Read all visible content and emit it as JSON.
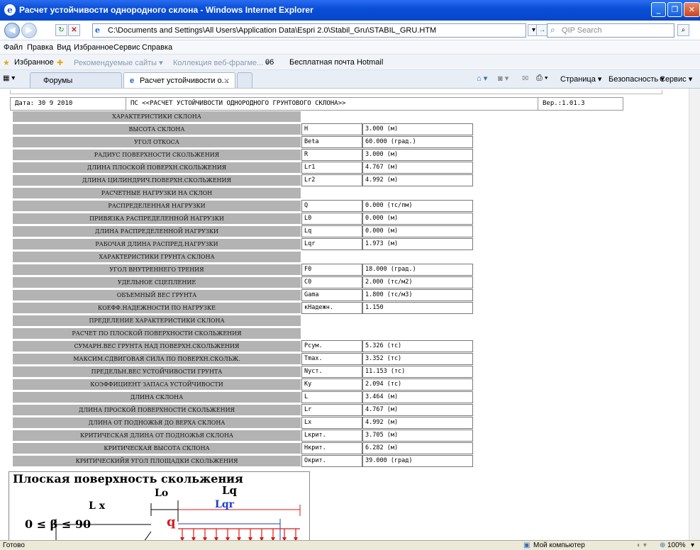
{
  "window": {
    "title": "Расчет устойчивости однородного склона - Windows Internet Explorer",
    "address": "C:\\Documents and Settings\\All Users\\Application Data\\Espri 2.0\\Stabil_Gru\\STABIL_GRU.HTM",
    "search_placeholder": "QIP Search"
  },
  "menu": [
    "Файл",
    "Правка",
    "Вид",
    "Избранное",
    "Сервис",
    "Справка"
  ],
  "favorites": {
    "label": "Избранное",
    "items": [
      "Рекомендуемые сайты ▾",
      "Коллекция веб-фрагме... ▾",
      "06",
      "Бесплатная почта Hotmail"
    ]
  },
  "tabs": {
    "left": "Форумы",
    "active": "Расчет устойчивости о...",
    "commands": [
      "Страница ▾",
      "Безопасность ▾",
      "Сервис ▾"
    ]
  },
  "report": {
    "date": "Дата: 30 9 2010",
    "heading": "ПС <<РАСЧЕТ УСТОЙЧИВОСТИ ОДНОРОДНОГО ГРУНТОВОГО СКЛОНА>>",
    "version": "Вер.:1.01.3",
    "rows": [
      {
        "label": "ХАРАКТЕРИСТИКИ СКЛОНА",
        "sym": "",
        "val": ""
      },
      {
        "label": "ВЫСОТА СКЛОНА",
        "sym": "H",
        "val": "3.000 (м)"
      },
      {
        "label": "УГОЛ ОТКОСА",
        "sym": "Beta",
        "val": "60.000 (град.)"
      },
      {
        "label": "РАДИУС ПОВЕРХНОСТИ СКОЛЬЖЕНИЯ",
        "sym": "R",
        "val": "3.000 (м)"
      },
      {
        "label": "ДЛИНА ПЛОСКОЙ ПОВЕРХН.СКОЛЬЖЕНИЯ",
        "sym": "Lr1",
        "val": "4.767 (м)"
      },
      {
        "label": "ДЛИНА ЦИЛИНДРИЧ.ПОВЕРХН.СКОЛЬЖЕНИЯ",
        "sym": "Lr2",
        "val": "4.992 (м)"
      },
      {
        "label": "РАСЧЕТНЫЕ НАГРУЗКИ НА СКЛОН",
        "sym": "",
        "val": ""
      },
      {
        "label": "РАСПРЕДЕЛЕННАЯ НАГРУЗКИ",
        "sym": "Q",
        "val": "0.000 (тс/пм)"
      },
      {
        "label": "ПРИВЯЗКА РАСПРЕДЕЛЕННОЙ НАГРУЗКИ",
        "sym": "L0",
        "val": "0.000 (м)"
      },
      {
        "label": "ДЛИНА РАСПРЕДЕЛЕННОЙ НАГРУЗКИ",
        "sym": "Lq",
        "val": "0.000 (м)"
      },
      {
        "label": "РАБОЧАЯ ДЛИНА РАСПРЕД.НАГРУЗКИ",
        "sym": "Lqr",
        "val": "1.973 (м)"
      },
      {
        "label": "ХАРАКТЕРИСТИКИ ГРУНТА СКЛОНА",
        "sym": "",
        "val": ""
      },
      {
        "label": "УГОЛ ВНУТРЕННЕГО ТРЕНИЯ",
        "sym": "F0",
        "val": "18.000 (град.)"
      },
      {
        "label": "УДЕЛЬНОЕ СЦЕПЛЕНИЕ",
        "sym": "C0",
        "val": "2.000 (тс/м2)"
      },
      {
        "label": "ОБЪЕМНЫЙ ВЕС ГРУНТА",
        "sym": "Gama",
        "val": "1.800 (тс/м3)"
      },
      {
        "label": "КОЕФФ.НАДЕЖНОСТИ ПО НАГРУЗКЕ",
        "sym": "кНадежн.",
        "val": "1.150"
      },
      {
        "label": "ПРЕДЕЛЕНИЕ ХАРАКТЕРИСТИКИ СКЛОНА",
        "sym": "",
        "val": ""
      },
      {
        "label": "РАСЧЕТ ПО ПЛОСКОЙ ПОВЕРХНОСТИ СКОЛЬЖЕНИЯ",
        "sym": "",
        "val": ""
      },
      {
        "label": "СУМАРН.ВЕС ГРУНТА НАД ПОВЕРХН.СКОЛЬЖЕНИЯ",
        "sym": "Pсум.",
        "val": "5.326 (тс)"
      },
      {
        "label": "МАКСИМ.СДВИГОВАЯ СИЛА ПО ПОВЕРХН.СКОЛЬЖ.",
        "sym": "Tmax.",
        "val": "3.352 (тс)"
      },
      {
        "label": "ПРЕДЕЛЬН.ВЕС УСТОЙЧИВОСТИ ГРУНТА",
        "sym": "Nуст.",
        "val": "11.153 (тс)"
      },
      {
        "label": "КОЭФФИЦИЕНТ ЗАПАСА УСТОЙЧИВОСТИ",
        "sym": "Ку",
        "val": "2.094 (тс)"
      },
      {
        "label": "ДЛИНА СКЛОНА",
        "sym": "L",
        "val": "3.464 (м)"
      },
      {
        "label": "ДЛИНА ПРОСКОЙ ПОВЕРХНОСТИ СКОЛЬЖЕНИЯ",
        "sym": "Lr",
        "val": "4.767 (м)"
      },
      {
        "label": "ДЛИНА ОТ ПОДНОЖЬЯ ДО ВЕРХА СКЛОНА",
        "sym": "Lx",
        "val": "4.992 (м)"
      },
      {
        "label": "КРИТИЧЕСКАЯ ДЛИНА ОТ ПОДНОЖЬЯ СКЛОНА",
        "sym": "Lкрит.",
        "val": "3.705 (м)"
      },
      {
        "label": "КРИТИЧЕСКАЯ ВЫСОТА СКЛОНА",
        "sym": "Hкрит.",
        "val": "6.282 (м)"
      },
      {
        "label": "КРИТИЧЕСКИЙЯ УГОЛ ПЛОЩАДКИ СКОЛЬЖЕНИЯ",
        "sym": "Окрит.",
        "val": "39.000 (град)"
      }
    ]
  },
  "diagram": {
    "title": "Плоская поверхность скольжения",
    "lo": "Lo",
    "lq": "Lq",
    "lx": "L x",
    "lqr": "Lqr",
    "q": "q",
    "beta": "0 ≤ β ≤ 90"
  },
  "status": {
    "left": "Готово",
    "zone": "Мой компьютер",
    "zoom": "100%"
  }
}
